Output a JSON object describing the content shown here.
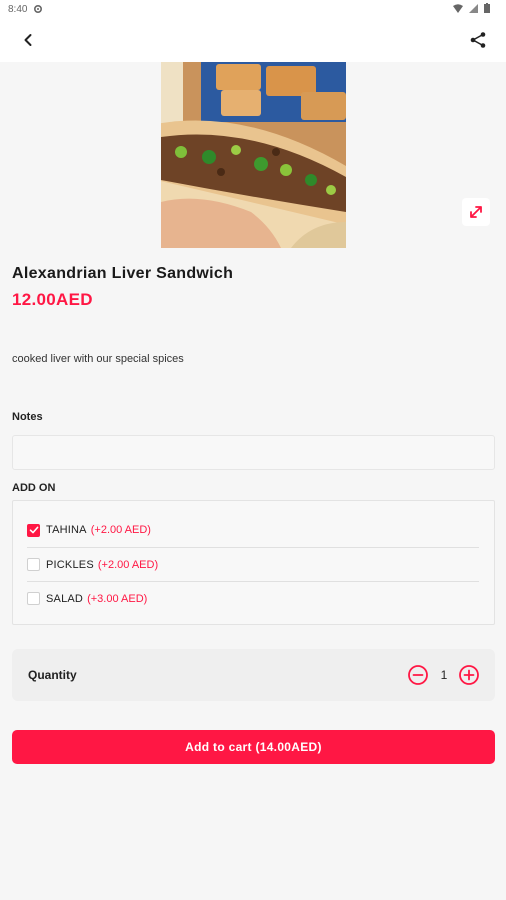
{
  "status_bar": {
    "time": "8:40",
    "icons": [
      "settings-icon",
      "wifi-icon",
      "signal-icon",
      "battery-icon"
    ]
  },
  "app_bar": {
    "back_icon": "chevron-left-icon",
    "share_icon": "share-icon"
  },
  "product": {
    "image_alt": "liver sandwich photo",
    "expand_icon": "expand-icon",
    "title": "Alexandrian Liver Sandwich",
    "price": "12.00AED",
    "description": "cooked liver with our special spices"
  },
  "notes": {
    "label": "Notes",
    "value": "",
    "placeholder": ""
  },
  "addons": {
    "label": "ADD ON",
    "items": [
      {
        "name": "TAHINA",
        "price": "(+2.00 AED)",
        "checked": true
      },
      {
        "name": "PICKLES",
        "price": "(+2.00 AED)",
        "checked": false
      },
      {
        "name": "SALAD",
        "price": "(+3.00 AED)",
        "checked": false
      }
    ]
  },
  "quantity": {
    "label": "Quantity",
    "value": "1"
  },
  "cart": {
    "label": "Add to cart (14.00AED)"
  },
  "colors": {
    "accent": "#ff1744",
    "background": "#f6f6f6"
  }
}
